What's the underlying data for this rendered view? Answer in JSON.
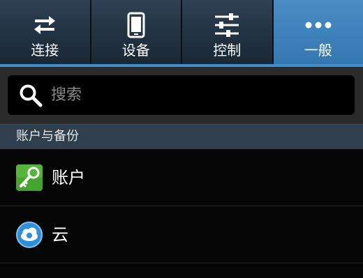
{
  "tabs": [
    {
      "label": "连接",
      "icon": "swap-arrows-icon",
      "active": false
    },
    {
      "label": "设备",
      "icon": "phone-device-icon",
      "active": false
    },
    {
      "label": "控制",
      "icon": "sliders-icon",
      "active": false
    },
    {
      "label": "一般",
      "icon": "more-dots-icon",
      "active": true
    }
  ],
  "search": {
    "placeholder": "搜索",
    "value": ""
  },
  "section": {
    "title": "账户与备份"
  },
  "items": [
    {
      "label": "账户",
      "icon": "key-icon"
    },
    {
      "label": "云",
      "icon": "cloud-icon"
    }
  ],
  "colors": {
    "active_tab": "#3f83bd",
    "tab_underline": "#3c8fd3",
    "section_header": "#2f3f4e",
    "key_icon": "#43a52b",
    "cloud_icon": "#2f8fd6"
  }
}
